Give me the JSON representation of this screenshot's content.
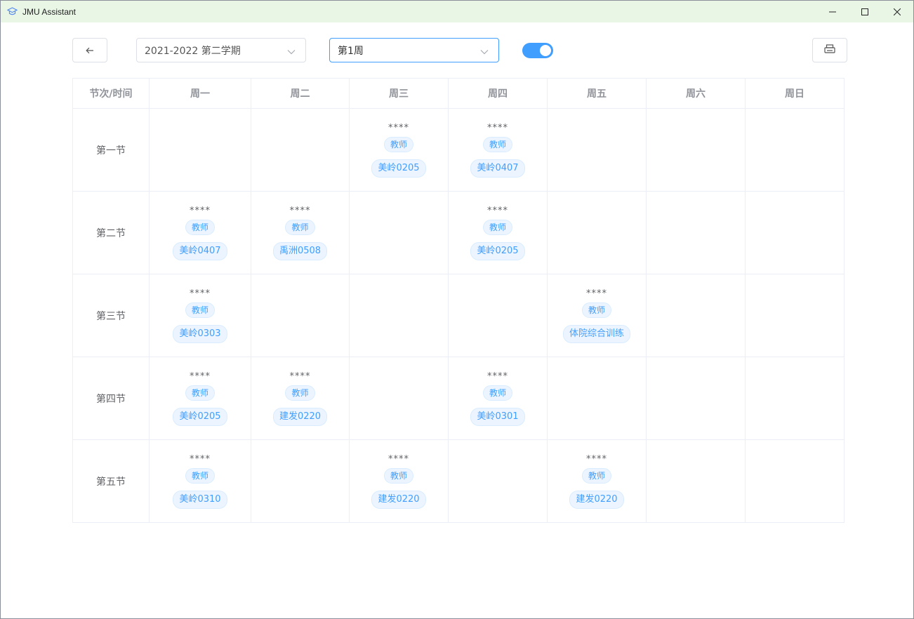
{
  "window": {
    "title": "JMU Assistant"
  },
  "toolbar": {
    "term_value": "2021-2022 第二学期",
    "week_value": "第1周",
    "toggle_on": true
  },
  "table": {
    "corner_header": "节次/时间",
    "days": [
      "周一",
      "周二",
      "周三",
      "周四",
      "周五",
      "周六",
      "周日"
    ],
    "rows": [
      {
        "label": "第一节",
        "cells": [
          null,
          null,
          {
            "name": "****",
            "teacher": "教师",
            "room": "美岭0205"
          },
          {
            "name": "****",
            "teacher": "教师",
            "room": "美岭0407"
          },
          null,
          null,
          null
        ]
      },
      {
        "label": "第二节",
        "cells": [
          {
            "name": "****",
            "teacher": "教师",
            "room": "美岭0407"
          },
          {
            "name": "****",
            "teacher": "教师",
            "room": "禹洲0508"
          },
          null,
          {
            "name": "****",
            "teacher": "教师",
            "room": "美岭0205"
          },
          null,
          null,
          null
        ]
      },
      {
        "label": "第三节",
        "cells": [
          {
            "name": "****",
            "teacher": "教师",
            "room": "美岭0303"
          },
          null,
          null,
          null,
          {
            "name": "****",
            "teacher": "教师",
            "room": "体院综合训练"
          },
          null,
          null
        ]
      },
      {
        "label": "第四节",
        "cells": [
          {
            "name": "****",
            "teacher": "教师",
            "room": "美岭0205"
          },
          {
            "name": "****",
            "teacher": "教师",
            "room": "建发0220"
          },
          null,
          {
            "name": "****",
            "teacher": "教师",
            "room": "美岭0301"
          },
          null,
          null,
          null
        ]
      },
      {
        "label": "第五节",
        "cells": [
          {
            "name": "****",
            "teacher": "教师",
            "room": "美岭0310"
          },
          null,
          {
            "name": "****",
            "teacher": "教师",
            "room": "建发0220"
          },
          null,
          {
            "name": "****",
            "teacher": "教师",
            "room": "建发0220"
          },
          null,
          null
        ]
      }
    ]
  },
  "colors": {
    "accent": "#409eff",
    "titlebar": "#e9f6e6",
    "tag_bg": "#ecf5ff"
  }
}
